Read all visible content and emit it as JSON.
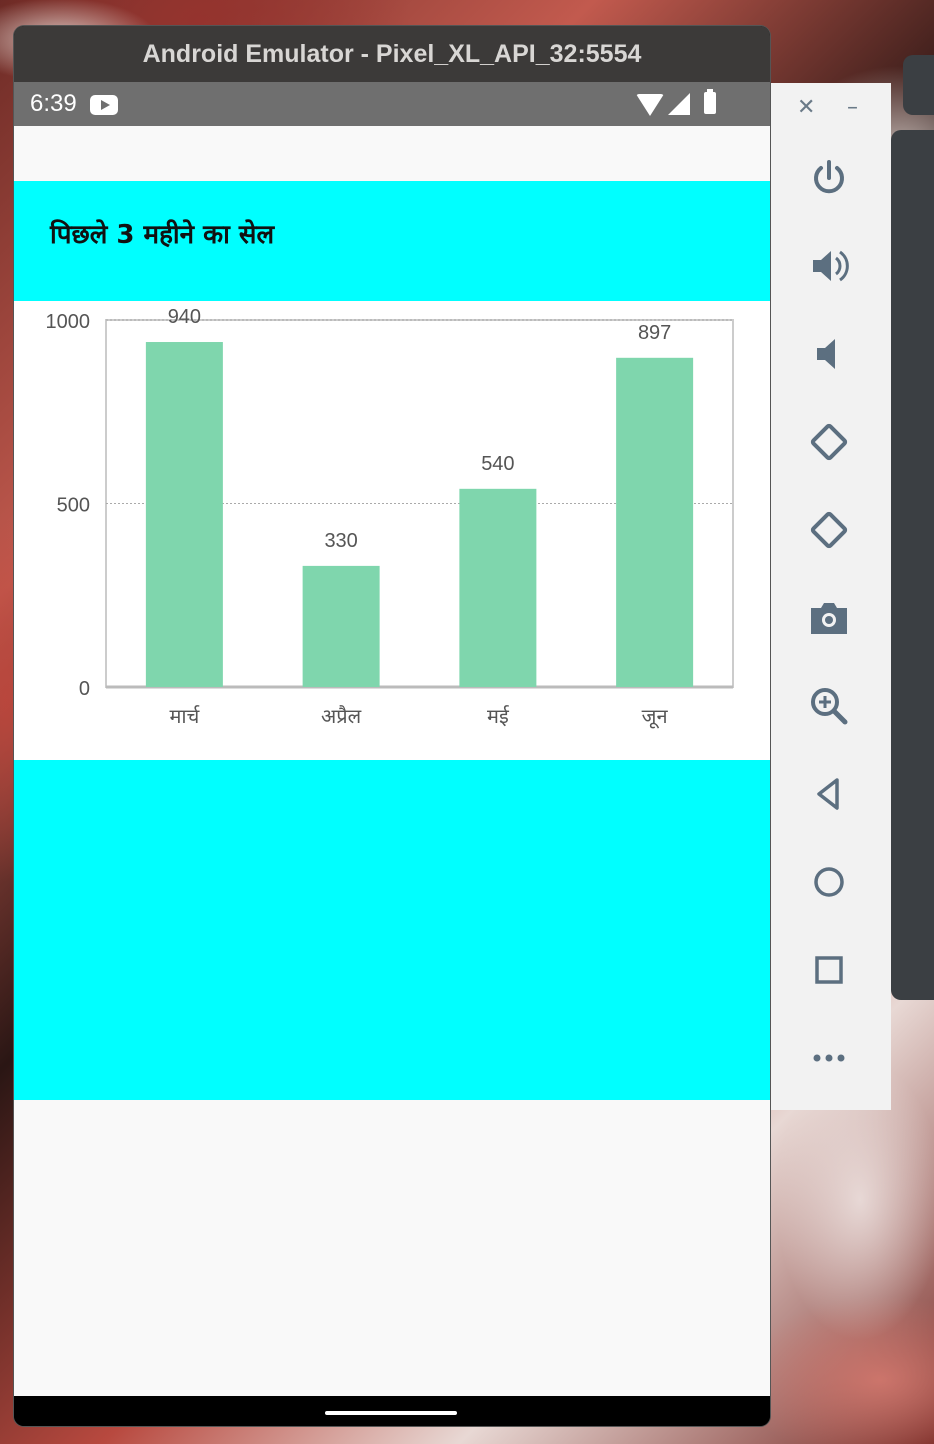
{
  "window": {
    "title": "Android Emulator - Pixel_XL_API_32:5554"
  },
  "status_bar": {
    "time": "6:39",
    "icons": [
      "youtube-icon",
      "wifi-icon",
      "signal-icon",
      "battery-icon"
    ]
  },
  "app": {
    "header_title": "पिछले 3 महीने का सेल",
    "colors": {
      "band": "#00ffff",
      "bar": "#7fd6ad"
    }
  },
  "chart_data": {
    "type": "bar",
    "categories": [
      "मार्च",
      "अप्रैल",
      "मई",
      "जून"
    ],
    "values": [
      940,
      330,
      540,
      897
    ],
    "data_labels": [
      "940",
      "330",
      "540",
      "897"
    ],
    "y_ticks": [
      "0",
      "500",
      "1000"
    ],
    "ylim": [
      0,
      1000
    ],
    "grid": true
  },
  "toolbar": {
    "top_controls": [
      "close-icon",
      "minimize-icon"
    ],
    "buttons": [
      "power-icon",
      "volume-up-icon",
      "volume-down-icon",
      "rotate-left-icon",
      "rotate-right-icon",
      "camera-icon",
      "zoom-icon",
      "back-icon",
      "home-icon",
      "overview-icon",
      "more-icon"
    ]
  }
}
